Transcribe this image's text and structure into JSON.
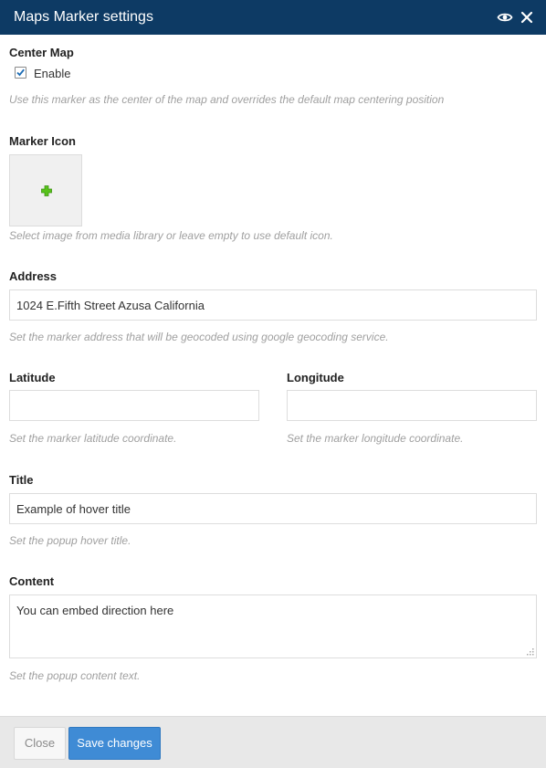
{
  "dialog": {
    "title": "Maps Marker settings",
    "header_icons": [
      "eye-icon",
      "close-icon"
    ]
  },
  "center_map": {
    "label": "Center Map",
    "checkbox_label": "Enable",
    "checked": true,
    "description": "Use this marker as the center of the map and overrides the default map centering position"
  },
  "marker_icon": {
    "label": "Marker Icon",
    "add_icon": "plus-icon",
    "description": "Select image from media library or leave empty to use default icon."
  },
  "address": {
    "label": "Address",
    "value": "1024 E.Fifth Street Azusa California",
    "description": "Set the marker address that will be geocoded using google geocoding service."
  },
  "latitude": {
    "label": "Latitude",
    "value": "",
    "description": "Set the marker latitude coordinate."
  },
  "longitude": {
    "label": "Longitude",
    "value": "",
    "description": "Set the marker longitude coordinate."
  },
  "title_field": {
    "label": "Title",
    "value": "Example of hover title",
    "description": "Set the popup hover title."
  },
  "content_field": {
    "label": "Content",
    "value": "You can embed direction here",
    "description": "Set the popup content text."
  },
  "footer": {
    "close_label": "Close",
    "save_label": "Save changes"
  },
  "colors": {
    "header_bg": "#0d3a64",
    "primary_button": "#3f8bd5",
    "plus_icon": "#57c21a"
  }
}
